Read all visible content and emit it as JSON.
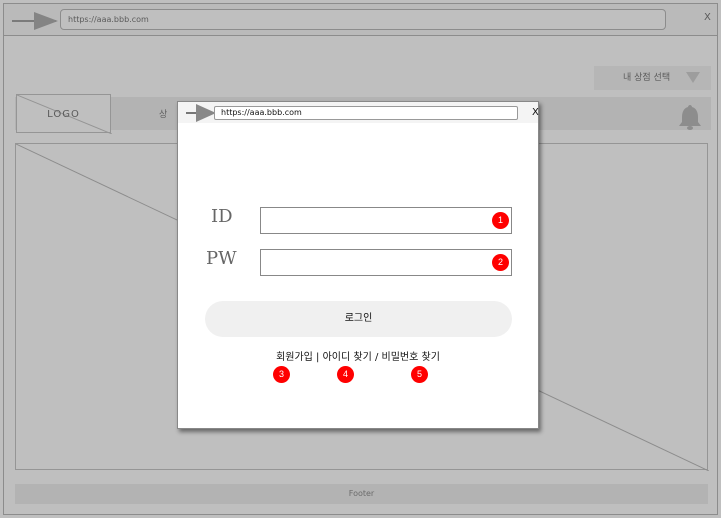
{
  "background": {
    "url": "https://aaa.bbb.com",
    "close_label": "X",
    "store_select_label": "내 상점 선택",
    "logo": "LOGO",
    "nav_partial": "상",
    "footer": "Footer"
  },
  "popup": {
    "url": "https://aaa.bbb.com",
    "close_label": "X",
    "id_label": "ID",
    "pw_label": "PW",
    "id_value": "",
    "pw_value": "",
    "login_button": "로그인",
    "links": {
      "signup": "회원가입",
      "sep1": " | ",
      "find_id": "아이디 찾기",
      "sep2": " / ",
      "find_pw": "비밀번호 찾기"
    }
  },
  "markers": [
    "1",
    "2",
    "3",
    "4",
    "5"
  ],
  "colors": {
    "marker": "#ff0000",
    "overlay": "#808080"
  },
  "icons": {
    "back_forward": "arrow-right-icon",
    "bell": "bell-icon",
    "dropdown": "triangle-down-icon"
  }
}
